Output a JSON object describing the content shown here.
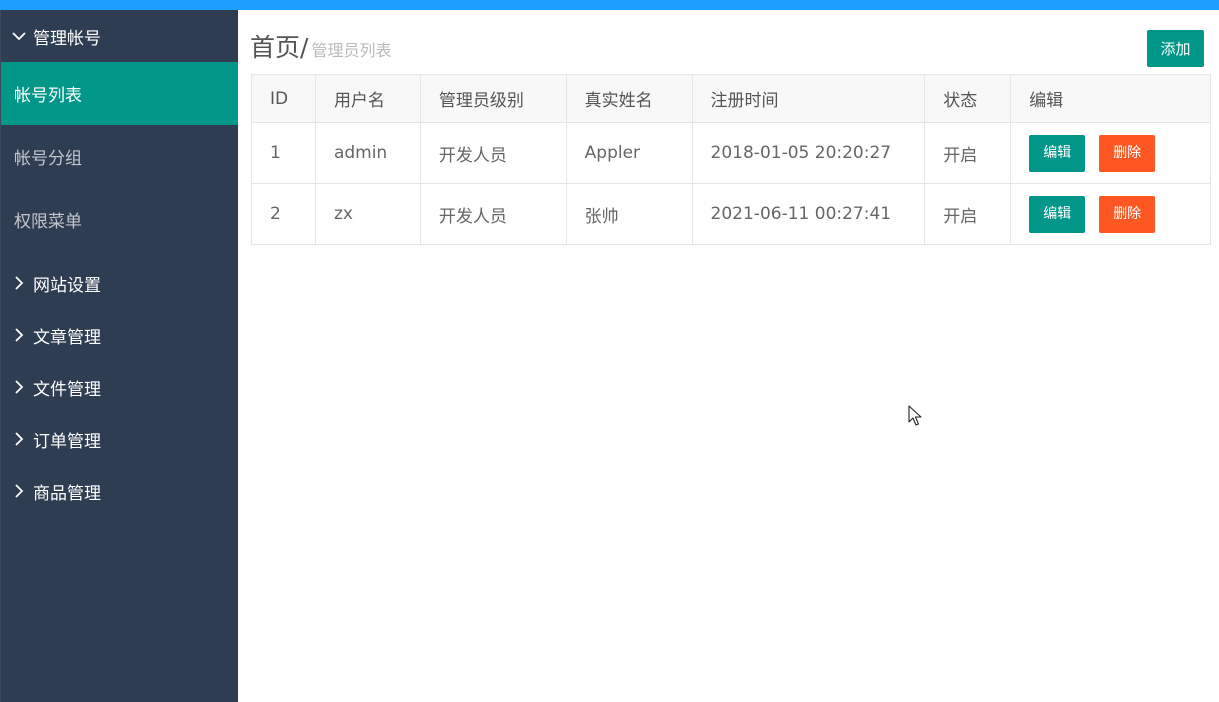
{
  "colors": {
    "top_bar": "#1e9fff",
    "sidebar_bg": "#2f3d52",
    "active": "#009688",
    "danger": "#ff5722"
  },
  "sidebar": {
    "expanded_group": {
      "label": "管理帐号",
      "icon": "chevron-down-icon"
    },
    "sub_items": [
      {
        "label": "帐号列表",
        "active": true
      },
      {
        "label": "帐号分组",
        "active": false
      },
      {
        "label": "权限菜单",
        "active": false
      }
    ],
    "groups": [
      {
        "label": "网站设置",
        "icon": "chevron-right-icon"
      },
      {
        "label": "文章管理",
        "icon": "chevron-right-icon"
      },
      {
        "label": "文件管理",
        "icon": "chevron-right-icon"
      },
      {
        "label": "订单管理",
        "icon": "chevron-right-icon"
      },
      {
        "label": "商品管理",
        "icon": "chevron-right-icon"
      }
    ]
  },
  "breadcrumb": {
    "home": "首页",
    "separator": "/",
    "current": "管理员列表"
  },
  "toolbar": {
    "add_label": "添加"
  },
  "table": {
    "headers": [
      "ID",
      "用户名",
      "管理员级别",
      "真实姓名",
      "注册时间",
      "状态",
      "编辑"
    ],
    "rows": [
      {
        "id": "1",
        "username": "admin",
        "level": "开发人员",
        "real_name": "Appler",
        "registered": "2018-01-05 20:20:27",
        "status": "开启",
        "edit_label": "编辑",
        "delete_label": "删除"
      },
      {
        "id": "2",
        "username": "zx",
        "level": "开发人员",
        "real_name": "张帅",
        "registered": "2021-06-11 00:27:41",
        "status": "开启",
        "edit_label": "编辑",
        "delete_label": "删除"
      }
    ]
  }
}
